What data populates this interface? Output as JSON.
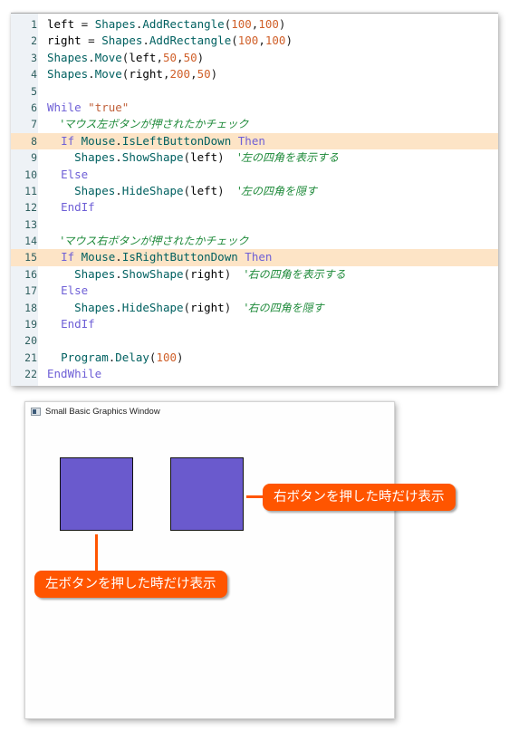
{
  "editor": {
    "lines": [
      {
        "n": "1",
        "highlight": false,
        "tokens": [
          [
            "id",
            "left"
          ],
          [
            "plain",
            " = "
          ],
          [
            "obj",
            "Shapes"
          ],
          [
            "plain",
            "."
          ],
          [
            "obj",
            "AddRectangle"
          ],
          [
            "plain",
            "("
          ],
          [
            "num",
            "100"
          ],
          [
            "plain",
            ","
          ],
          [
            "num",
            "100"
          ],
          [
            "plain",
            ")"
          ]
        ]
      },
      {
        "n": "2",
        "highlight": false,
        "tokens": [
          [
            "id",
            "right"
          ],
          [
            "plain",
            " = "
          ],
          [
            "obj",
            "Shapes"
          ],
          [
            "plain",
            "."
          ],
          [
            "obj",
            "AddRectangle"
          ],
          [
            "plain",
            "("
          ],
          [
            "num",
            "100"
          ],
          [
            "plain",
            ","
          ],
          [
            "num",
            "100"
          ],
          [
            "plain",
            ")"
          ]
        ]
      },
      {
        "n": "3",
        "highlight": false,
        "tokens": [
          [
            "obj",
            "Shapes"
          ],
          [
            "plain",
            "."
          ],
          [
            "obj",
            "Move"
          ],
          [
            "plain",
            "("
          ],
          [
            "id",
            "left"
          ],
          [
            "plain",
            ","
          ],
          [
            "num",
            "50"
          ],
          [
            "plain",
            ","
          ],
          [
            "num",
            "50"
          ],
          [
            "plain",
            ")"
          ]
        ]
      },
      {
        "n": "4",
        "highlight": false,
        "tokens": [
          [
            "obj",
            "Shapes"
          ],
          [
            "plain",
            "."
          ],
          [
            "obj",
            "Move"
          ],
          [
            "plain",
            "("
          ],
          [
            "id",
            "right"
          ],
          [
            "plain",
            ","
          ],
          [
            "num",
            "200"
          ],
          [
            "plain",
            ","
          ],
          [
            "num",
            "50"
          ],
          [
            "plain",
            ")"
          ]
        ]
      },
      {
        "n": "5",
        "highlight": false,
        "tokens": []
      },
      {
        "n": "6",
        "highlight": false,
        "tokens": [
          [
            "kw",
            "While"
          ],
          [
            "plain",
            " "
          ],
          [
            "str",
            "\"true\""
          ]
        ]
      },
      {
        "n": "7",
        "highlight": false,
        "tokens": [
          [
            "plain",
            "  "
          ],
          [
            "cmt",
            "'マウス左ボタンが押されたかチェック"
          ]
        ]
      },
      {
        "n": "8",
        "highlight": true,
        "tokens": [
          [
            "plain",
            "  "
          ],
          [
            "kw",
            "If"
          ],
          [
            "plain",
            " "
          ],
          [
            "obj",
            "Mouse"
          ],
          [
            "plain",
            "."
          ],
          [
            "obj",
            "IsLeftButtonDown"
          ],
          [
            "plain",
            " "
          ],
          [
            "kw",
            "Then"
          ]
        ]
      },
      {
        "n": "9",
        "highlight": false,
        "tokens": [
          [
            "plain",
            "    "
          ],
          [
            "obj",
            "Shapes"
          ],
          [
            "plain",
            "."
          ],
          [
            "obj",
            "ShowShape"
          ],
          [
            "plain",
            "("
          ],
          [
            "id",
            "left"
          ],
          [
            "plain",
            ")  "
          ],
          [
            "cmt",
            "'左の四角を表示する"
          ]
        ]
      },
      {
        "n": "10",
        "highlight": false,
        "tokens": [
          [
            "plain",
            "  "
          ],
          [
            "kw",
            "Else"
          ]
        ]
      },
      {
        "n": "11",
        "highlight": false,
        "tokens": [
          [
            "plain",
            "    "
          ],
          [
            "obj",
            "Shapes"
          ],
          [
            "plain",
            "."
          ],
          [
            "obj",
            "HideShape"
          ],
          [
            "plain",
            "("
          ],
          [
            "id",
            "left"
          ],
          [
            "plain",
            ")  "
          ],
          [
            "cmt",
            "'左の四角を隠す"
          ]
        ]
      },
      {
        "n": "12",
        "highlight": false,
        "tokens": [
          [
            "plain",
            "  "
          ],
          [
            "kw",
            "EndIf"
          ]
        ]
      },
      {
        "n": "13",
        "highlight": false,
        "tokens": []
      },
      {
        "n": "14",
        "highlight": false,
        "tokens": [
          [
            "plain",
            "  "
          ],
          [
            "cmt",
            "'マウス右ボタンが押されたかチェック"
          ]
        ]
      },
      {
        "n": "15",
        "highlight": true,
        "tokens": [
          [
            "plain",
            "  "
          ],
          [
            "kw",
            "If"
          ],
          [
            "plain",
            " "
          ],
          [
            "obj",
            "Mouse"
          ],
          [
            "plain",
            "."
          ],
          [
            "obj",
            "IsRightButtonDown"
          ],
          [
            "plain",
            " "
          ],
          [
            "kw",
            "Then"
          ]
        ]
      },
      {
        "n": "16",
        "highlight": false,
        "tokens": [
          [
            "plain",
            "    "
          ],
          [
            "obj",
            "Shapes"
          ],
          [
            "plain",
            "."
          ],
          [
            "obj",
            "ShowShape"
          ],
          [
            "plain",
            "("
          ],
          [
            "id",
            "right"
          ],
          [
            "plain",
            ")  "
          ],
          [
            "cmt",
            "'右の四角を表示する"
          ]
        ]
      },
      {
        "n": "17",
        "highlight": false,
        "tokens": [
          [
            "plain",
            "  "
          ],
          [
            "kw",
            "Else"
          ]
        ]
      },
      {
        "n": "18",
        "highlight": false,
        "tokens": [
          [
            "plain",
            "    "
          ],
          [
            "obj",
            "Shapes"
          ],
          [
            "plain",
            "."
          ],
          [
            "obj",
            "HideShape"
          ],
          [
            "plain",
            "("
          ],
          [
            "id",
            "right"
          ],
          [
            "plain",
            ")  "
          ],
          [
            "cmt",
            "'右の四角を隠す"
          ]
        ]
      },
      {
        "n": "19",
        "highlight": false,
        "tokens": [
          [
            "plain",
            "  "
          ],
          [
            "kw",
            "EndIf"
          ]
        ]
      },
      {
        "n": "20",
        "highlight": false,
        "tokens": []
      },
      {
        "n": "21",
        "highlight": false,
        "tokens": [
          [
            "plain",
            "  "
          ],
          [
            "obj",
            "Program"
          ],
          [
            "plain",
            "."
          ],
          [
            "obj",
            "Delay"
          ],
          [
            "plain",
            "("
          ],
          [
            "num",
            "100"
          ],
          [
            "plain",
            ")"
          ]
        ]
      },
      {
        "n": "22",
        "highlight": false,
        "tokens": [
          [
            "kw",
            "EndWhile"
          ]
        ]
      }
    ]
  },
  "graphics_window": {
    "title": "Small Basic Graphics Window",
    "shape_color": "#6a5acd"
  },
  "callouts": {
    "right": "右ボタンを押した時だけ表示",
    "left": "左ボタンを押した時だけ表示",
    "color": "#ff5500"
  }
}
